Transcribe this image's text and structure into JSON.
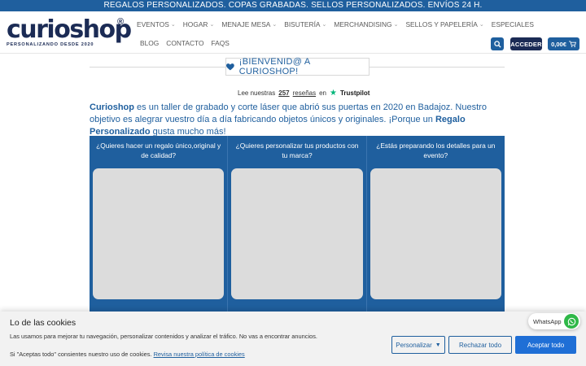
{
  "topbar": {
    "text": "REGALOS PERSONALIZADOS. COPAS GRABADAS. SELLOS PERSONALIZADOS. ENVÍOS 24 H."
  },
  "logo": {
    "word": "curioshop",
    "registered": "®",
    "tagline": "PERSONALIZANDO DESDE 2020"
  },
  "nav": {
    "row1": [
      {
        "label": "EVENTOS",
        "dropdown": true
      },
      {
        "label": "HOGAR",
        "dropdown": true
      },
      {
        "label": "MENAJE MESA",
        "dropdown": true
      },
      {
        "label": "BISUTERÍA",
        "dropdown": true
      },
      {
        "label": "MERCHANDISING",
        "dropdown": true
      },
      {
        "label": "SELLOS Y PAPELERÍA",
        "dropdown": true
      },
      {
        "label": "ESPECIALES",
        "dropdown": false
      }
    ],
    "row2": [
      {
        "label": "BLOG"
      },
      {
        "label": "CONTACTO"
      },
      {
        "label": "FAQS"
      }
    ]
  },
  "header": {
    "acceder": "ACCEDER",
    "cart_total": "0,00€",
    "search_icon": "search-icon",
    "cart_icon": "cart-icon"
  },
  "welcome": {
    "text": "¡BIENVENID@ A CURIOSHOP!",
    "icon": "heart-icon"
  },
  "trustpilot": {
    "prefix": "Lee nuestras",
    "count": "257",
    "suffix": "reseñas",
    "on": "en",
    "brand": "Trustpilot"
  },
  "intro": {
    "brand": "Curioshop",
    "text1": " es un taller de grabado y corte láser que abrió sus puertas en 2020 en Badajoz. Nuestro objetivo es alegrar vuestro día a día fabricando objetos únicos y originales. ¡Porque un ",
    "highlight": "Regalo Personalizado",
    "text2": " gusta mucho más!"
  },
  "cards": [
    {
      "question": "¿Quieres hacer un regalo único,original y de calidad?"
    },
    {
      "question": "¿Quieres personalizar tus productos con tu marca?"
    },
    {
      "question": "¿Estás preparando los detalles para un evento?"
    }
  ],
  "whatsapp": {
    "label": "WhatsApp"
  },
  "cookie": {
    "title": "Lo de las cookies",
    "line1": "Las usamos para mejorar tu navegación, personalizar contenidos y analizar el tráfico. No vas a encontrar anuncios.",
    "line2_prefix": "Si \"Aceptas todo\" consientes nuestro uso de cookies.",
    "policy_link": "Revisa nuestra política de cookies",
    "btn_personalizar": "Personalizar",
    "btn_rechazar": "Rechazar todo",
    "btn_aceptar": "Aceptar todo"
  },
  "colors": {
    "primary": "#1f5f9e",
    "dark": "#1b2b55",
    "accept": "#1f6fd6",
    "whatsapp": "#2fb848",
    "trustpilot": "#00b67a"
  }
}
